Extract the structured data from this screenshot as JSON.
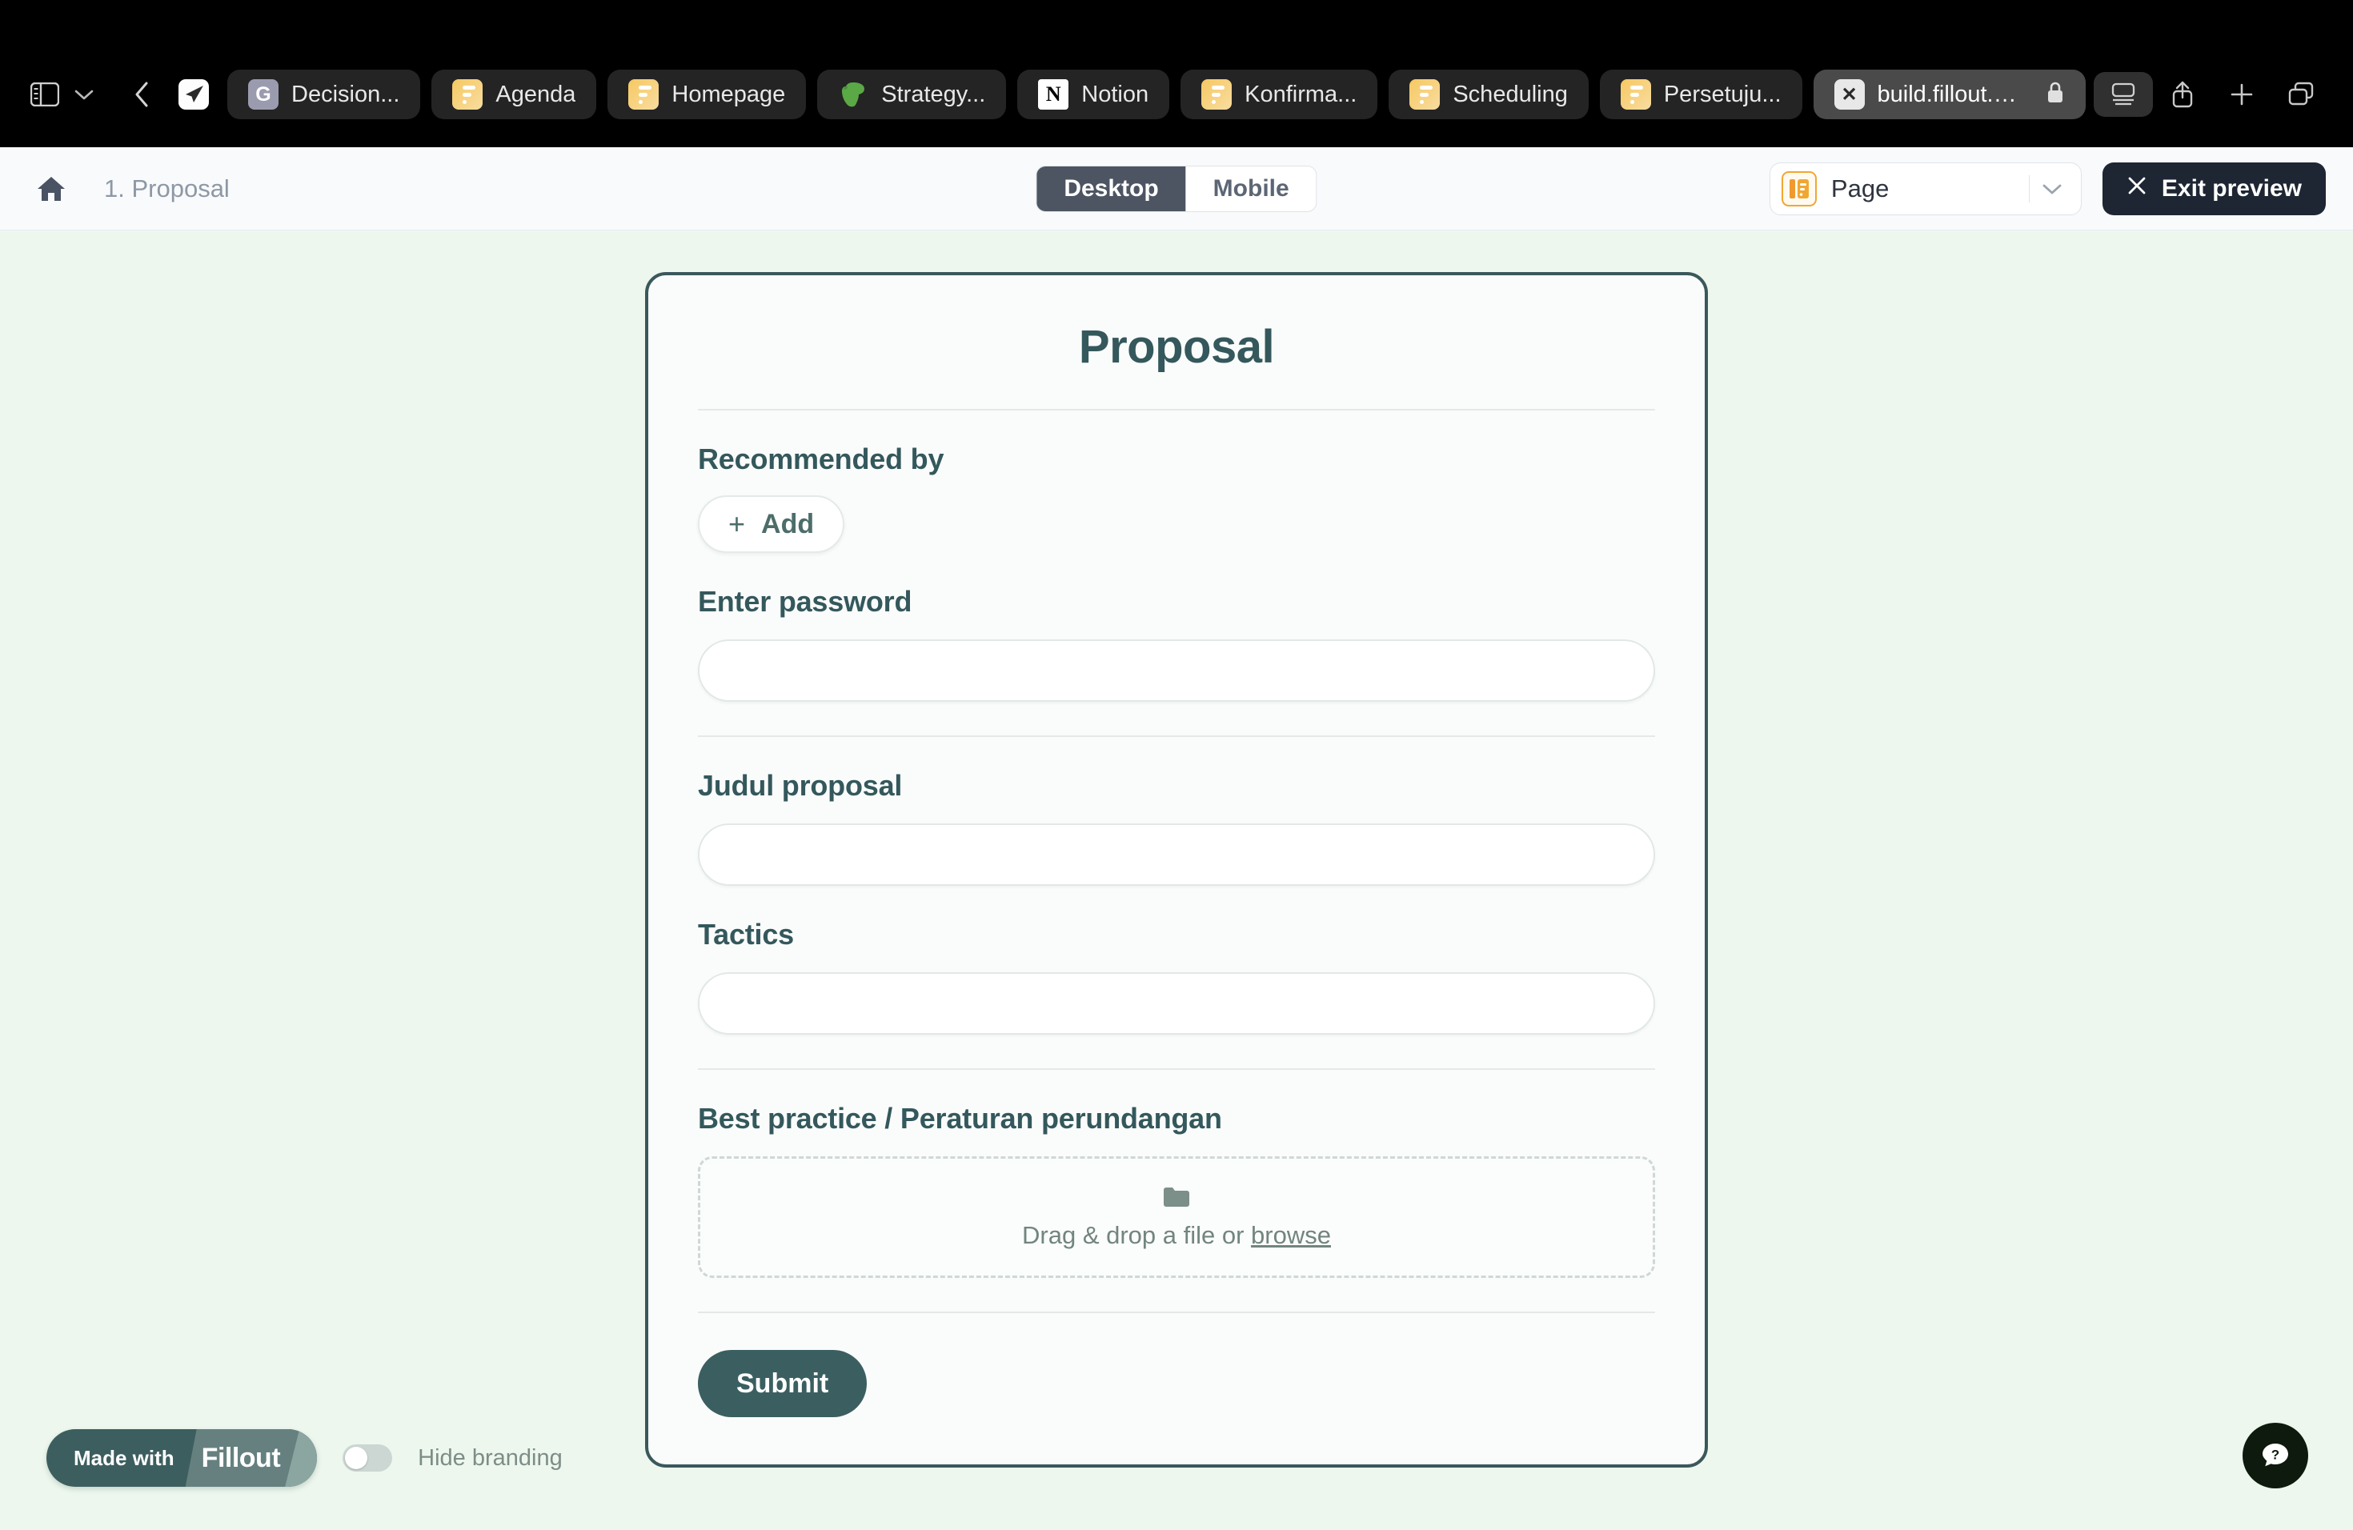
{
  "browser": {
    "tabs": [
      {
        "label": "Decision...",
        "favicon": "g-docs-icon",
        "active": false
      },
      {
        "label": "Agenda",
        "favicon": "fillout-icon",
        "active": false
      },
      {
        "label": "Homepage",
        "favicon": "fillout-icon",
        "active": false
      },
      {
        "label": "Strategy...",
        "favicon": "evernote-icon",
        "active": false
      },
      {
        "label": "Notion",
        "favicon": "notion-icon",
        "active": false
      },
      {
        "label": "Konfirma...",
        "favicon": "fillout-icon",
        "active": false
      },
      {
        "label": "Scheduling",
        "favicon": "fillout-icon",
        "active": false
      },
      {
        "label": "Persetuju...",
        "favicon": "fillout-icon",
        "active": false
      },
      {
        "label": "build.fillout.com",
        "favicon": "x-icon",
        "active": true,
        "secure": true
      }
    ],
    "controls": {
      "sidebar": "sidebar-toggle-icon",
      "chevron": "chevron-down-icon",
      "back": "back-arrow-icon",
      "app_favicon": "paper-plane-icon",
      "reader": "reader-view-icon",
      "share": "share-icon",
      "new_tab": "plus-icon",
      "tab_overview": "tab-overview-icon",
      "lock_glyph": "🔒"
    }
  },
  "header": {
    "home_icon": "home-icon",
    "breadcrumb": "1. Proposal",
    "device_toggle": {
      "options": [
        "Desktop",
        "Mobile"
      ],
      "selected": "Desktop"
    },
    "page_select": {
      "value": "Page",
      "icon": "page-layout-icon",
      "caret": "chevron-down-icon"
    },
    "exit_preview": {
      "label": "Exit preview",
      "icon": "close-icon"
    }
  },
  "form": {
    "title": "Proposal",
    "fields": [
      {
        "label": "Recommended by",
        "type": "add-button",
        "add_label": "Add",
        "plus": "+"
      },
      {
        "label": "Enter password",
        "type": "text",
        "value": "",
        "placeholder": ""
      },
      {
        "label": "Judul proposal",
        "type": "text",
        "value": "",
        "placeholder": ""
      },
      {
        "label": "Tactics",
        "type": "text",
        "value": "",
        "placeholder": ""
      },
      {
        "label": "Best practice / Peraturan perundangan",
        "type": "file",
        "drop_text": "Drag & drop a file or ",
        "browse_text": "browse",
        "icon": "folder-icon"
      }
    ],
    "submit_label": "Submit"
  },
  "branding": {
    "made_with": "Made with",
    "brand": "Fillout",
    "hide_branding_label": "Hide branding",
    "hide_branding_on": false
  },
  "help": {
    "icon": "help-question-bubble-icon"
  },
  "colors": {
    "page_background": "#edf7ee",
    "card_border": "#3b585c",
    "accent_teal": "#34585c",
    "submit_teal": "#3b5f60",
    "header_background": "#f8fafb",
    "toggle_selected": "#4d5563",
    "exit_button": "#1e2633",
    "page_icon_orange": "#f0a732"
  }
}
